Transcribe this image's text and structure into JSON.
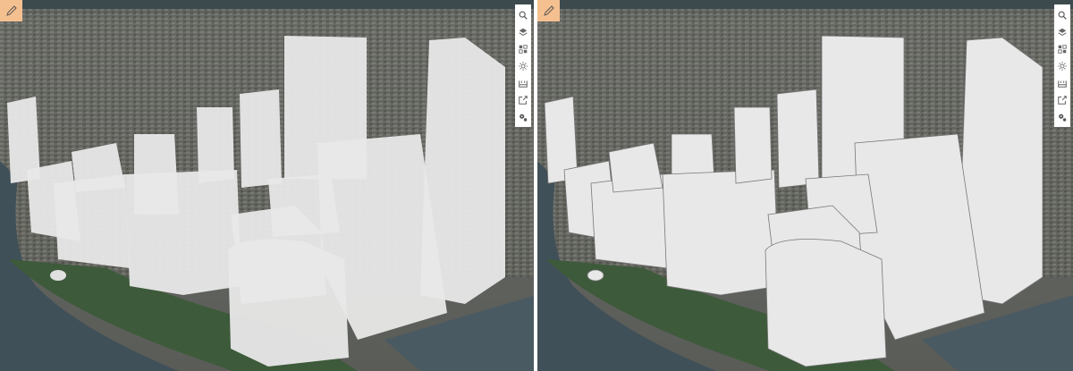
{
  "colors": {
    "edit_button": "#f5c08f",
    "toolbar_bg": "#ffffff",
    "building": "#e8e8e8",
    "ground": "#5d5f5c",
    "water": "#3f4c52",
    "park": "#3d5a3a"
  },
  "views": [
    {
      "name": "left",
      "building_style": "textured-white"
    },
    {
      "name": "right",
      "building_style": "outlined-white"
    }
  ],
  "edit_button": {
    "icon": "pencil-icon"
  },
  "toolbar": {
    "items": [
      {
        "icon": "search-icon"
      },
      {
        "icon": "layers-icon"
      },
      {
        "icon": "basemap-gallery-icon"
      },
      {
        "icon": "daylight-icon"
      },
      {
        "icon": "measure-icon"
      },
      {
        "icon": "share-icon"
      },
      {
        "icon": "settings-icon"
      }
    ]
  }
}
